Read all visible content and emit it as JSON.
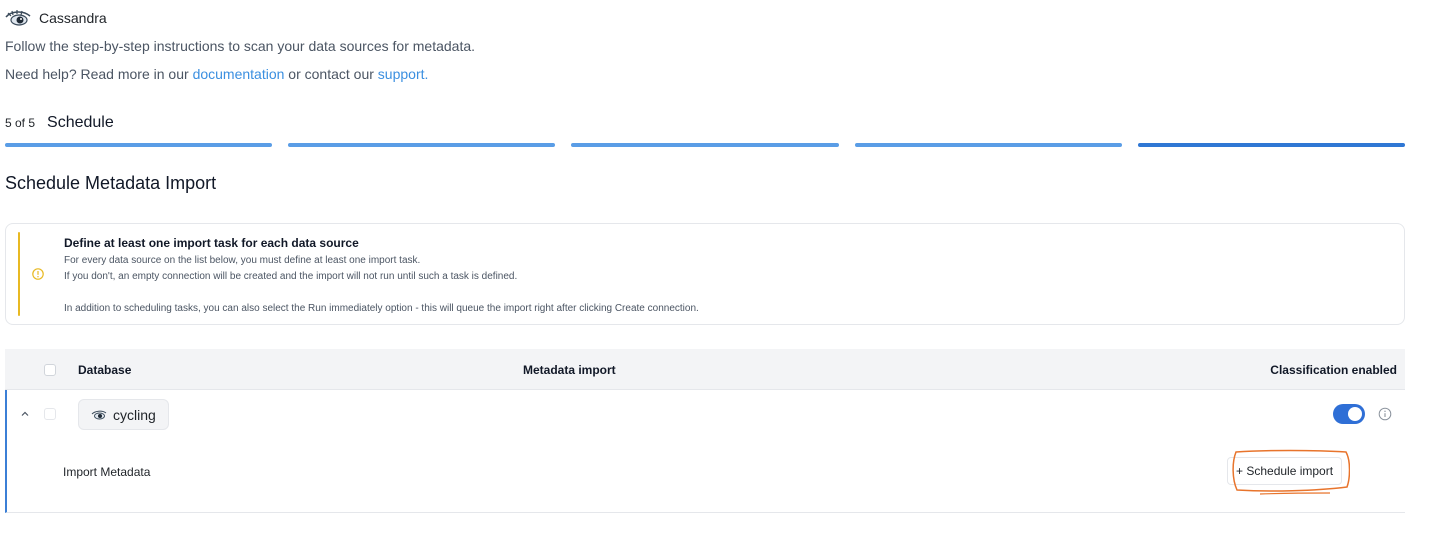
{
  "header": {
    "title": "Cassandra",
    "logo_icon": "cassandra-eye-icon"
  },
  "intro": "Follow the step-by-step instructions to scan your data sources for metadata.",
  "help": {
    "prefix": "Need help? Read more in our ",
    "documentation_link": "documentation",
    "middle": " or contact our ",
    "support_link": "support."
  },
  "step": {
    "count": "5 of 5",
    "name": "Schedule",
    "total": 5,
    "current": 5
  },
  "section_title": "Schedule Metadata Import",
  "alert": {
    "heading": "Define at least one import task for each data source",
    "line1": "For every data source on the list below, you must define at least one import task.",
    "line2": "If you don't, an empty connection will be created and the import will not run until such a task is defined.",
    "line3": "In addition to scheduling tasks, you can also select the Run immediately option - this will queue the import right after clicking Create connection.",
    "accent_color": "#e8b923"
  },
  "table": {
    "columns": {
      "database": "Database",
      "metadata_import": "Metadata import",
      "classification_enabled": "Classification enabled"
    },
    "rows": [
      {
        "database": "cycling",
        "classification_enabled": true,
        "import_label": "Import Metadata",
        "schedule_button": "+ Schedule import"
      }
    ]
  },
  "colors": {
    "link": "#3b8fe0",
    "progress": "#5a9de6",
    "toggle": "#2f6fd6",
    "annotation": "#e8742c"
  }
}
